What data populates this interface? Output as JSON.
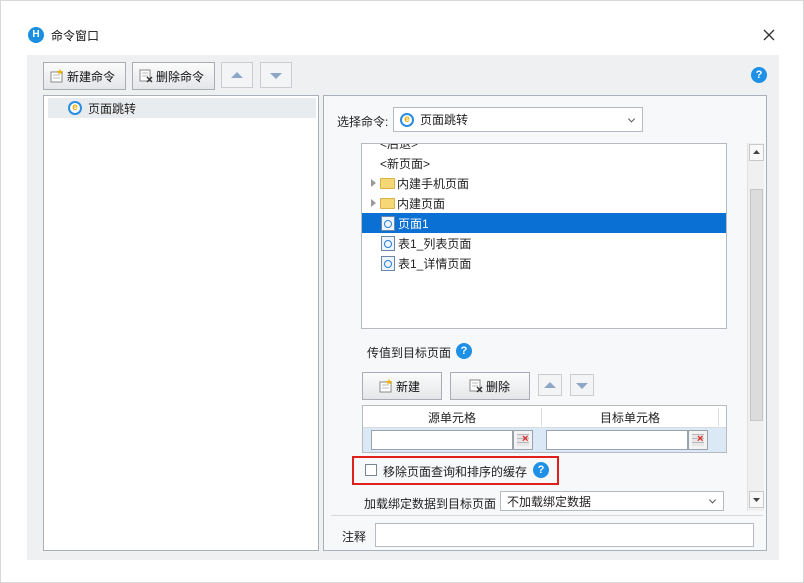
{
  "window": {
    "title": "命令窗口",
    "app_icon_letter": "H"
  },
  "toolbar": {
    "new_command": "新建命令",
    "delete_command": "删除命令"
  },
  "left_panel": {
    "commands": [
      {
        "label": "页面跳转"
      }
    ]
  },
  "right_panel": {
    "select_command_label": "选择命令:",
    "select_command_value": "页面跳转",
    "tree": {
      "items": [
        {
          "label": "<后退>",
          "type": "text"
        },
        {
          "label": "<新页面>",
          "type": "text"
        },
        {
          "label": "内建手机页面",
          "type": "folder"
        },
        {
          "label": "内建页面",
          "type": "folder"
        },
        {
          "label": "页面1",
          "type": "page",
          "selected": true
        },
        {
          "label": "表1_列表页面",
          "type": "page"
        },
        {
          "label": "表1_详情页面",
          "type": "page"
        }
      ]
    },
    "pass_values_label": "传值到目标页面",
    "grid_toolbar": {
      "new": "新建",
      "delete": "删除"
    },
    "grid": {
      "columns": [
        "源单元格",
        "目标单元格"
      ],
      "rows": [
        {
          "source": "",
          "target": ""
        }
      ]
    },
    "remove_cache_label": "移除页面查询和排序的缓存",
    "load_binding_label": "加载绑定数据到目标页面",
    "load_binding_value": "不加载绑定数据",
    "notes_label": "注释",
    "notes_value": ""
  },
  "colors": {
    "accent": "#1e90e6",
    "selection": "#0a70d4",
    "highlight": "#e0201b"
  }
}
